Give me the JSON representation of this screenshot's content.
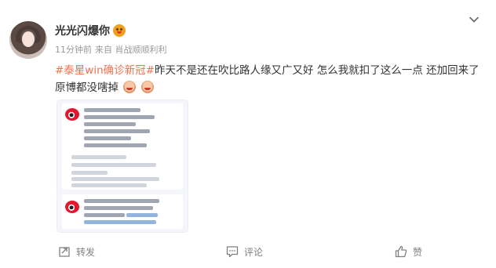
{
  "post": {
    "username": "光光闪爆你",
    "vip_badge_icon": "smile-badge-icon",
    "time": "11分钟前",
    "source": "来自 肖战顺顺利利",
    "topic": "#泰星win确诊新冠#",
    "body": "昨天不是还在吹比路人缘又广又好 怎么我就扣了这么一点 还加回来了 原博都没嗐掉",
    "topic_color": "#eb7350"
  },
  "thumbnail": {
    "icon": "weibo-logo-icon"
  },
  "actions": {
    "repost": "转发",
    "comment": "评论",
    "like": "赞"
  },
  "menu_icon": "chevron-down-icon"
}
